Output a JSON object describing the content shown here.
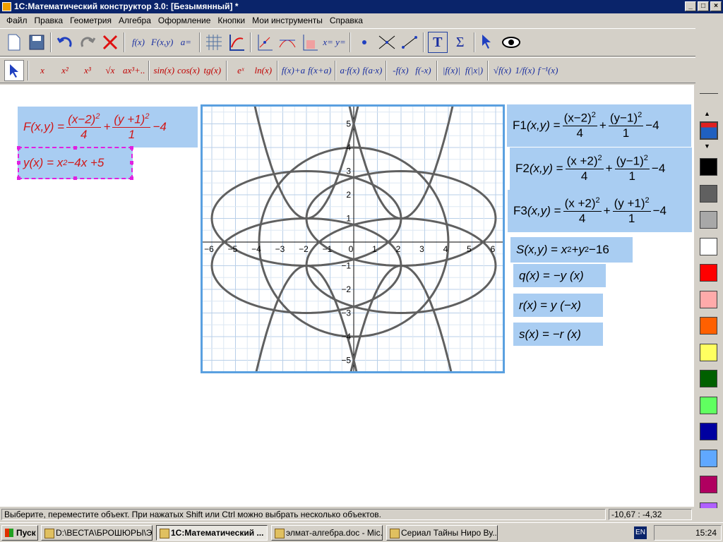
{
  "window": {
    "title": "1С:Математический конструктор 3.0: [Безымянный] *"
  },
  "menu": [
    "Файл",
    "Правка",
    "Геометрия",
    "Алгебра",
    "Оформление",
    "Кнопки",
    "Мои инструменты",
    "Справка"
  ],
  "toolbar1": {
    "fx": "f(x)",
    "fxy": "F(x,y)",
    "aparam": "a=",
    "xy": "x= y=",
    "text": "T",
    "sum": "Σ"
  },
  "toolbar2": [
    "x",
    "x²",
    "x³",
    "√x",
    "ax³+..",
    "sin(x)",
    "cos(x)",
    "tg(x)",
    "eˣ",
    "ln(x)",
    "f(x)+a",
    "f(x+a)",
    "a·f(x)",
    "f(a·x)",
    "-f(x)",
    "f(-x)",
    "|f(x)|",
    "f(|x|)",
    "√f(x)",
    "1/f(x)",
    "f⁻¹(x)"
  ],
  "formulas": {
    "F": {
      "name": "F",
      "args": "(x,y)",
      "eq": "=",
      "n1": "(x−2)",
      "p1": "2",
      "d1": "4",
      "op": "+",
      "n2": "(y +1)",
      "p2": "2",
      "d2": "1",
      "tail": "−4"
    },
    "y": {
      "name": "y",
      "args": "(x)",
      "eq": "=",
      "x": "x",
      "p": "2",
      "rest": "−4x +5"
    },
    "F1": {
      "name": "F1",
      "args": "(x,y)",
      "eq": "=",
      "n1": "(x−2)",
      "p1": "2",
      "d1": "4",
      "op": "+",
      "n2": "(y−1)",
      "p2": "2",
      "d2": "1",
      "tail": "−4"
    },
    "F2": {
      "name": "F2",
      "args": "(x,y)",
      "eq": "=",
      "n1": "(x +2)",
      "p1": "2",
      "d1": "4",
      "op": "+",
      "n2": "(y−1)",
      "p2": "2",
      "d2": "1",
      "tail": "−4"
    },
    "F3": {
      "name": "F3",
      "args": "(x,y)",
      "eq": "=",
      "n1": "(x +2)",
      "p1": "2",
      "d1": "4",
      "op": "+",
      "n2": "(y +1)",
      "p2": "2",
      "d2": "1",
      "tail": "−4"
    },
    "S": {
      "name": "S",
      "args": "(x,y)",
      "eq": "=",
      "x": "x",
      "p": "2",
      "mid": "+y",
      "p2": "2",
      "rest": "−16"
    },
    "q": {
      "name": "q",
      "args": "(x)",
      "eq": "=",
      "rest": "−y (x)"
    },
    "r": {
      "name": "r",
      "args": "(x)",
      "eq": "=",
      "rest": "y (−x)"
    },
    "s": {
      "name": "s",
      "args": "(x)",
      "eq": "=",
      "rest": "−r (x)"
    }
  },
  "graph": {
    "xticks": [
      "−6",
      "−5",
      "−4",
      "−3",
      "−2",
      "−1",
      "0",
      "1",
      "2",
      "3",
      "4",
      "5",
      "6"
    ],
    "yticks": [
      "5",
      "4",
      "3",
      "2",
      "1",
      "−1",
      "−2",
      "−3",
      "−4",
      "−5"
    ],
    "curve_color": "#606060"
  },
  "palette": [
    "#000000",
    "#606060",
    "#a8a8a8",
    "#ffffff",
    "#ff0000",
    "#ffaaaa",
    "#ff6000",
    "#ffff60",
    "#006000",
    "#60ff60",
    "#0000a0",
    "#60a8ff",
    "#b00060",
    "#b060ff"
  ],
  "status": {
    "message": "Выберите, переместите объект. При нажатых Shift или Ctrl можно выбрать несколько объектов.",
    "coords": "-10,67 : -4,32"
  },
  "taskbar": {
    "start": "Пуск",
    "tasks": [
      "D:\\ВЕСТА\\БРОШЮРЫ\\Э...",
      "1С:Математический ...",
      "элмат-алгебра.doc - Mic...",
      "Сериал Тайны Ниро Ву..."
    ],
    "lang": "EN",
    "clock": "15:24"
  }
}
